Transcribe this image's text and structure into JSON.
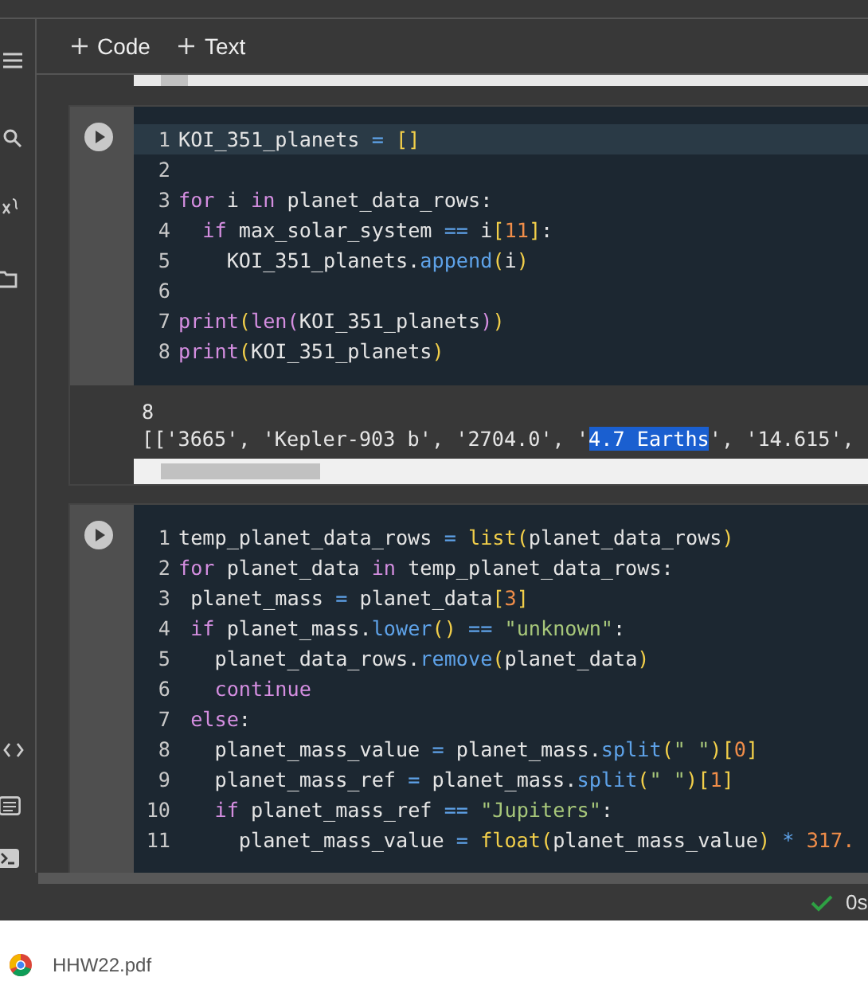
{
  "toolbar": {
    "buttons": [
      "Code",
      "Text"
    ]
  },
  "cells": [
    {
      "lines": [
        {
          "number": "1",
          "highlighted": true,
          "tokens": [
            {
              "text": "KOI_351_planets ",
              "kind": "plain"
            },
            {
              "text": "= ",
              "kind": "operator"
            },
            {
              "text": "[]",
              "kind": "bracket"
            }
          ]
        },
        {
          "number": "2",
          "highlighted": false
        },
        {
          "number": "3",
          "highlighted": false,
          "tokens": [
            {
              "text": "for",
              "kind": "keyword"
            },
            {
              "text": " i ",
              "kind": "plain"
            },
            {
              "text": "in",
              "kind": "keyword"
            },
            {
              "text": " planet_data_rows:",
              "kind": "plain"
            }
          ]
        },
        {
          "number": "4",
          "highlighted": false,
          "tokens": [
            {
              "text": "  if",
              "kind": "keyword"
            },
            {
              "text": " max_solar_system ",
              "kind": "plain"
            },
            {
              "text": "==",
              "kind": "operator"
            },
            {
              "text": " i",
              "kind": "plain"
            },
            {
              "text": "[",
              "kind": "bracket"
            },
            {
              "text": "11",
              "kind": "number"
            },
            {
              "text": "]",
              "kind": "bracket"
            },
            {
              "text": ":",
              "kind": "plain"
            }
          ]
        },
        {
          "number": "5",
          "highlighted": false,
          "tokens": [
            {
              "text": "    KOI_351_planets.",
              "kind": "plain"
            },
            {
              "text": "append",
              "kind": "method"
            },
            {
              "text": "(",
              "kind": "bracket"
            },
            {
              "text": "i",
              "kind": "plain"
            },
            {
              "text": ")",
              "kind": "bracket"
            }
          ]
        },
        {
          "number": "6",
          "highlighted": false
        },
        {
          "number": "7",
          "highlighted": false,
          "tokens": [
            {
              "text": "print",
              "kind": "keyword"
            },
            {
              "text": "(",
              "kind": "bracket"
            },
            {
              "text": "len",
              "kind": "keyword"
            },
            {
              "text": "(",
              "kind": "bracket2"
            },
            {
              "text": "KOI_351_planets",
              "kind": "plain"
            },
            {
              "text": ")",
              "kind": "bracket2"
            },
            {
              "text": ")",
              "kind": "bracket"
            }
          ]
        },
        {
          "number": "8",
          "highlighted": false,
          "tokens": [
            {
              "text": "print",
              "kind": "keyword"
            },
            {
              "text": "(",
              "kind": "bracket"
            },
            {
              "text": "KOI_351_planets",
              "kind": "plain"
            },
            {
              "text": ")",
              "kind": "bracket"
            }
          ]
        }
      ],
      "output": [
        [
          {
            "text": "8",
            "selected": false
          }
        ],
        [
          {
            "text": "[['3665', 'Kepler-903 b', '2704.0', '",
            "selected": false
          },
          {
            "text": "4.7 Earths",
            "selected": true
          },
          {
            "text": "', '14.615',",
            "selected": false
          }
        ]
      ]
    },
    {
      "lines": [
        {
          "number": "1",
          "highlighted": false,
          "tokens": [
            {
              "text": "temp_planet_data_rows ",
              "kind": "plain"
            },
            {
              "text": "= ",
              "kind": "operator"
            },
            {
              "text": "list",
              "kind": "function"
            },
            {
              "text": "(",
              "kind": "bracket"
            },
            {
              "text": "planet_data_rows",
              "kind": "plain"
            },
            {
              "text": ")",
              "kind": "bracket"
            }
          ]
        },
        {
          "number": "2",
          "highlighted": false,
          "tokens": [
            {
              "text": "for",
              "kind": "keyword"
            },
            {
              "text": " planet_data ",
              "kind": "plain"
            },
            {
              "text": "in",
              "kind": "keyword"
            },
            {
              "text": " temp_planet_data_rows:",
              "kind": "plain"
            }
          ]
        },
        {
          "number": "3",
          "highlighted": false,
          "tokens": [
            {
              "text": " planet_mass ",
              "kind": "plain"
            },
            {
              "text": "=",
              "kind": "operator"
            },
            {
              "text": " planet_data",
              "kind": "plain"
            },
            {
              "text": "[",
              "kind": "bracket"
            },
            {
              "text": "3",
              "kind": "number"
            },
            {
              "text": "]",
              "kind": "bracket"
            }
          ]
        },
        {
          "number": "4",
          "highlighted": false,
          "tokens": [
            {
              "text": " if",
              "kind": "keyword"
            },
            {
              "text": " planet_mass.",
              "kind": "plain"
            },
            {
              "text": "lower",
              "kind": "method"
            },
            {
              "text": "() ",
              "kind": "bracket"
            },
            {
              "text": "== ",
              "kind": "operator"
            },
            {
              "text": "\"unknown\"",
              "kind": "string"
            },
            {
              "text": ":",
              "kind": "plain"
            }
          ]
        },
        {
          "number": "5",
          "highlighted": false,
          "tokens": [
            {
              "text": "   planet_data_rows.",
              "kind": "plain"
            },
            {
              "text": "remove",
              "kind": "method"
            },
            {
              "text": "(",
              "kind": "bracket"
            },
            {
              "text": "planet_data",
              "kind": "plain"
            },
            {
              "text": ")",
              "kind": "bracket"
            }
          ]
        },
        {
          "number": "6",
          "highlighted": false,
          "tokens": [
            {
              "text": "   continue",
              "kind": "keyword"
            }
          ]
        },
        {
          "number": "7",
          "highlighted": false,
          "tokens": [
            {
              "text": " else",
              "kind": "keyword"
            },
            {
              "text": ":",
              "kind": "plain"
            }
          ]
        },
        {
          "number": "8",
          "highlighted": false,
          "tokens": [
            {
              "text": "   planet_mass_value ",
              "kind": "plain"
            },
            {
              "text": "=",
              "kind": "operator"
            },
            {
              "text": " planet_mass.",
              "kind": "plain"
            },
            {
              "text": "split",
              "kind": "method"
            },
            {
              "text": "(",
              "kind": "bracket"
            },
            {
              "text": "\" \"",
              "kind": "string"
            },
            {
              "text": ")",
              "kind": "bracket"
            },
            {
              "text": "[",
              "kind": "bracket"
            },
            {
              "text": "0",
              "kind": "number"
            },
            {
              "text": "]",
              "kind": "bracket"
            }
          ]
        },
        {
          "number": "9",
          "highlighted": false,
          "tokens": [
            {
              "text": "   planet_mass_ref ",
              "kind": "plain"
            },
            {
              "text": "=",
              "kind": "operator"
            },
            {
              "text": " planet_mass.",
              "kind": "plain"
            },
            {
              "text": "split",
              "kind": "method"
            },
            {
              "text": "(",
              "kind": "bracket"
            },
            {
              "text": "\" \"",
              "kind": "string"
            },
            {
              "text": ")",
              "kind": "bracket"
            },
            {
              "text": "[",
              "kind": "bracket"
            },
            {
              "text": "1",
              "kind": "number"
            },
            {
              "text": "]",
              "kind": "bracket"
            }
          ]
        },
        {
          "number": "10",
          "highlighted": false,
          "tokens": [
            {
              "text": "   if",
              "kind": "keyword"
            },
            {
              "text": " planet_mass_ref ",
              "kind": "plain"
            },
            {
              "text": "== ",
              "kind": "operator"
            },
            {
              "text": "\"Jupiters\"",
              "kind": "string"
            },
            {
              "text": ":",
              "kind": "plain"
            }
          ]
        },
        {
          "number": "11",
          "highlighted": false,
          "tokens": [
            {
              "text": "     planet_mass_value ",
              "kind": "plain"
            },
            {
              "text": "= ",
              "kind": "operator"
            },
            {
              "text": "float",
              "kind": "function"
            },
            {
              "text": "(",
              "kind": "bracket"
            },
            {
              "text": "planet_mass_value",
              "kind": "plain"
            },
            {
              "text": ") ",
              "kind": "bracket"
            },
            {
              "text": "* ",
              "kind": "operator"
            },
            {
              "text": "317.",
              "kind": "number"
            }
          ]
        }
      ]
    }
  ],
  "status_bar": {
    "elapsed": "0s"
  },
  "downloads": [
    {
      "file": "HHW22.pdf"
    }
  ]
}
